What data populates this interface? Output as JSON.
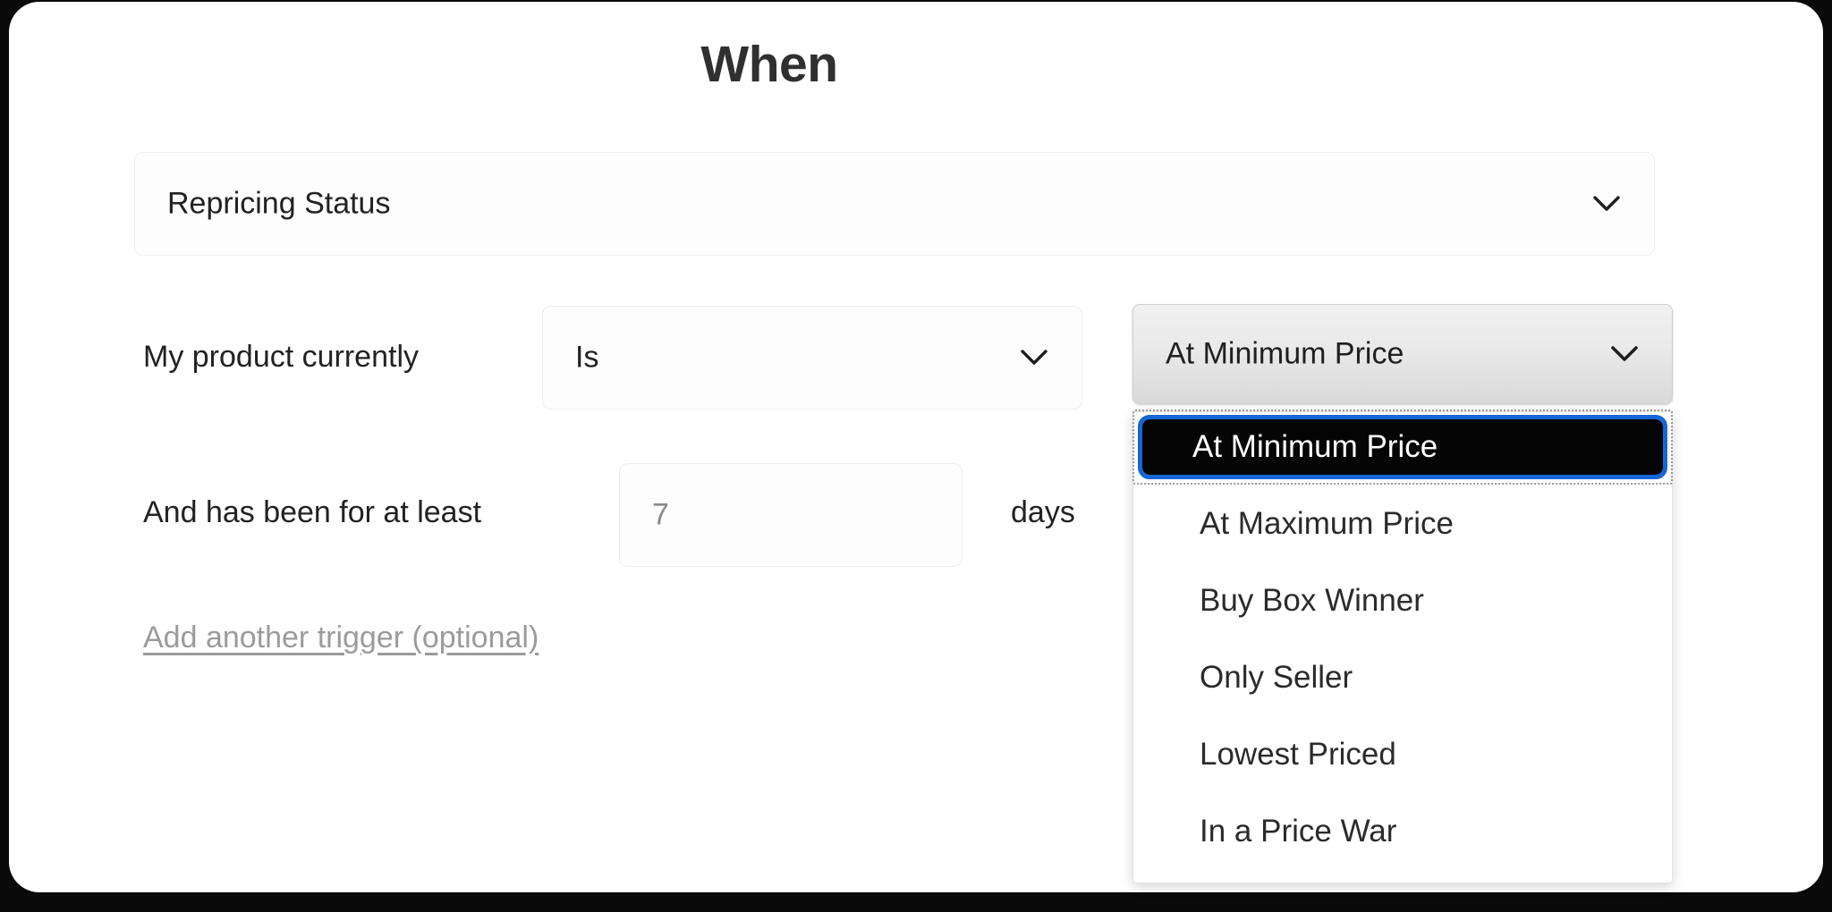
{
  "card": {
    "title": "When"
  },
  "trigger_type": {
    "name": "trigger-type-select",
    "value": "Repricing Status",
    "icon": "chevron-down-icon"
  },
  "condition_row": {
    "label": "My product currently",
    "operator": {
      "value": "Is",
      "icon": "chevron-down-icon"
    },
    "status_value": {
      "value": "At Minimum Price",
      "icon": "chevron-down-icon",
      "expanded": true,
      "options": [
        "At Minimum Price",
        "At Maximum Price",
        "Buy Box Winner",
        "Only Seller",
        "Lowest Priced",
        "In a Price War"
      ],
      "selected_index": 0
    }
  },
  "duration_row": {
    "label": "And has been for at least",
    "input_value": "7",
    "input_placeholder": "7",
    "unit_label": "days"
  },
  "add_trigger": {
    "label": "Add another trigger (optional)"
  },
  "colors": {
    "focus_ring": "#1566d6",
    "selected_background": "#050505",
    "selected_text": "#ffffff",
    "title_text": "#303030",
    "link_text": "#9b9b9b",
    "frame": "#0a0a0a"
  }
}
